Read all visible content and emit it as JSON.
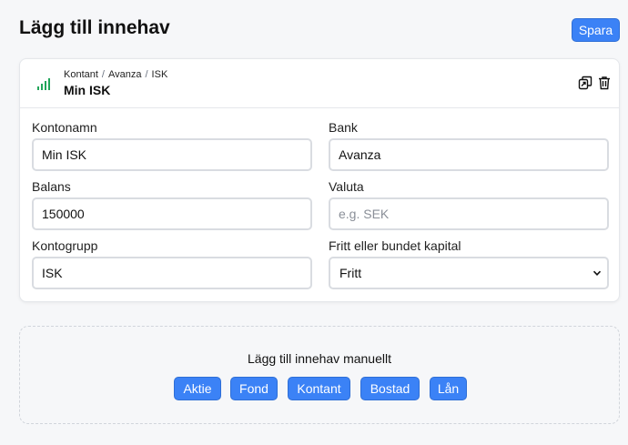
{
  "page": {
    "title": "Lägg till innehav"
  },
  "toolbar": {
    "save_label": "Spara"
  },
  "account": {
    "breadcrumb": [
      "Kontant",
      "Avanza",
      "ISK"
    ],
    "title": "Min ISK",
    "icons": [
      "signal-bars-icon",
      "copy-icon",
      "trash-icon"
    ],
    "accent_color": "#22a55a"
  },
  "form": {
    "account_name": {
      "label": "Kontonamn",
      "value": "Min ISK"
    },
    "bank": {
      "label": "Bank",
      "value": "Avanza"
    },
    "balance": {
      "label": "Balans",
      "value": "150000"
    },
    "currency": {
      "label": "Valuta",
      "value": "",
      "placeholder": "e.g. SEK"
    },
    "account_group": {
      "label": "Kontogrupp",
      "value": "ISK"
    },
    "capital_type": {
      "label": "Fritt eller bundet kapital",
      "selected": "Fritt"
    }
  },
  "manual": {
    "title": "Lägg till innehav manuellt",
    "buttons": [
      "Aktie",
      "Fond",
      "Kontant",
      "Bostad",
      "Lån"
    ]
  },
  "colors": {
    "primary": "#3b82f6",
    "background": "#f6f7f9"
  }
}
